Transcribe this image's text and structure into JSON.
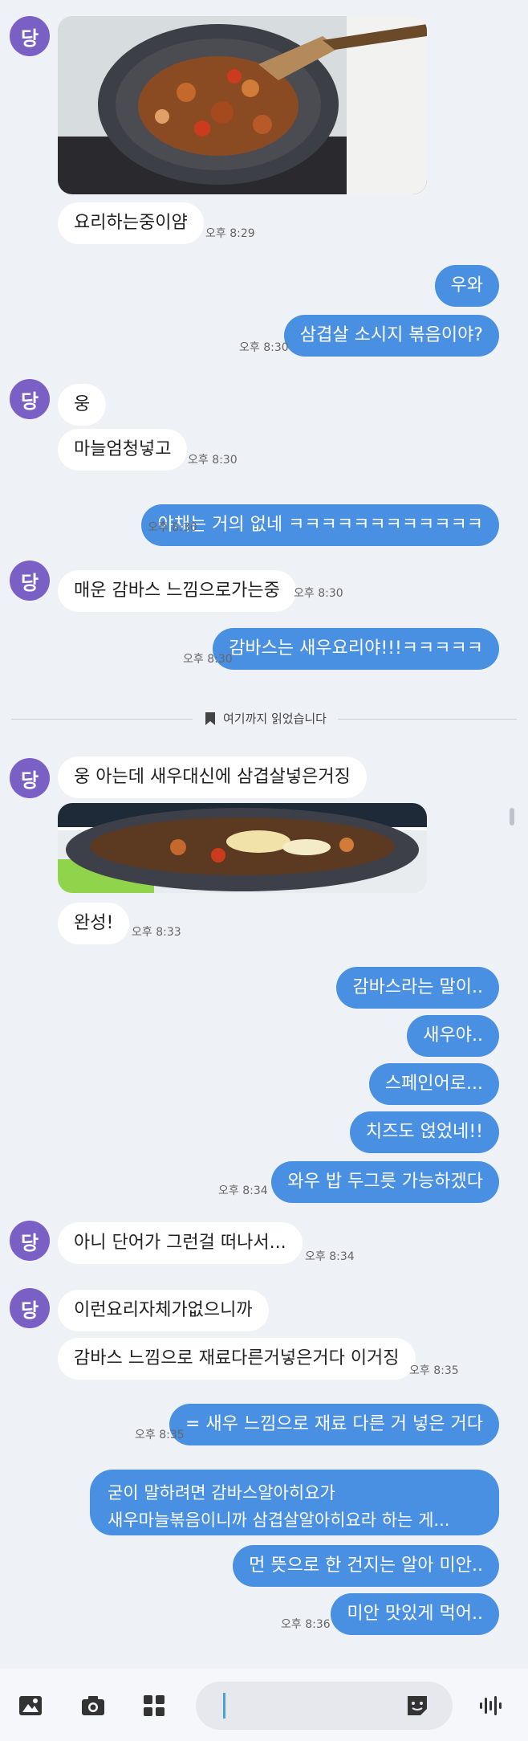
{
  "avatar_initial": "당",
  "messages": {
    "m1": "요리하는중이얌",
    "t1": "오후 8:29",
    "m2": "우와",
    "m3": "삼겹살 소시지 볶음이야?",
    "t3": "오후 8:30",
    "m4": "웅",
    "m5": "마늘엄청넣고",
    "t5": "오후 8:30",
    "m6": "야채는 거의 없네 ㅋㅋㅋㅋㅋㅋㅋㅋㅋㅋㅋㅋ",
    "t6": "오후 8:30",
    "m7": "매운 감바스 느낌으로가는중",
    "t7": "오후 8:30",
    "m8": "감바스는 새우요리야!!!ㅋㅋㅋㅋㅋ",
    "t8": "오후 8:30",
    "divider": "여기까지 읽었습니다",
    "m9": "웅 아는데 새우대신에 삼겹살넣은거징",
    "m10": "완성!",
    "t10": "오후 8:33",
    "m11": "감바스라는 말이..",
    "m12": "새우야..",
    "m13": "스페인어로...",
    "m14": "치즈도 얹었네!!",
    "m15": "와우 밥 두그릇 가능하겠다",
    "t15": "오후 8:34",
    "m16": "아니 단어가  그런걸 떠나서...",
    "t16": "오후 8:34",
    "m17": "이런요리자체가없으니까",
    "m18": "감바스  느낌으로 재료다른거넣은거다 이거징",
    "t18": "오후 8:35",
    "m19": "= 새우 느낌으로 재료 다른 거 넣은 거다",
    "t19": "오후 8:35",
    "m20a": "굳이 말하려면 감바스알아히요가",
    "m20b": "새우마늘볶음이니까 삼겹살알아히요라 하는 게...",
    "m21": "먼 뜻으로 한 건지는 알아 미안..",
    "m22": "미안 맛있게 먹어..",
    "t22": "오후 8:36"
  },
  "icons": [
    "image-icon",
    "camera-icon",
    "grid-icon",
    "sticker-icon",
    "voice-icon"
  ],
  "colors": {
    "out_bubble": "#4a90e2",
    "in_bubble": "#ffffff",
    "avatar": "#7a5fc4",
    "background": "#eef1f6"
  }
}
